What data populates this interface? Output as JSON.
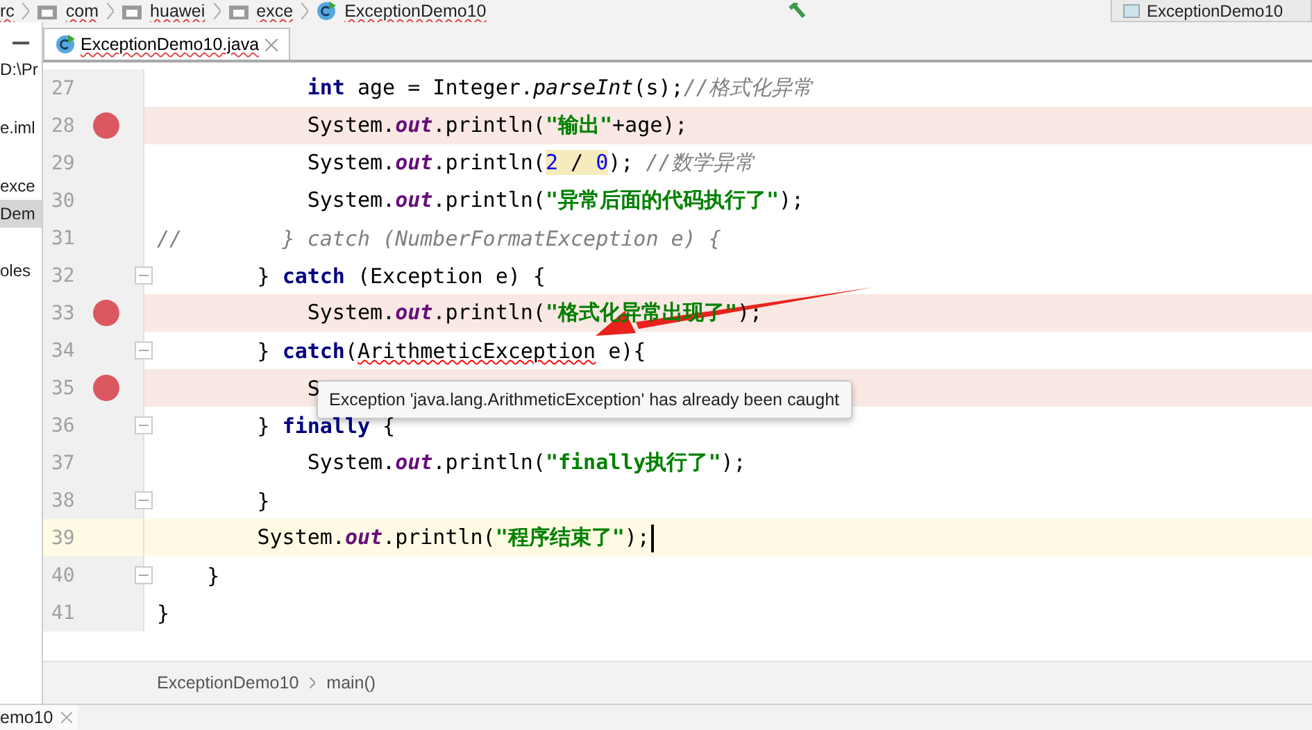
{
  "nav_bar": {
    "crumbs": [
      {
        "label": "rc",
        "kind": "text"
      },
      {
        "label": "com",
        "kind": "folder"
      },
      {
        "label": "huawei",
        "kind": "folder"
      },
      {
        "label": "exce",
        "kind": "folder"
      },
      {
        "label": "ExceptionDemo10",
        "kind": "class"
      }
    ],
    "run_config": "ExceptionDemo10"
  },
  "editor_tabs": [
    {
      "label": "ExceptionDemo10.java",
      "selected": true
    }
  ],
  "project_panel": {
    "items": [
      {
        "label": "D:\\Pr",
        "selected": false
      },
      {
        "label": "e.iml",
        "selected": false
      },
      {
        "label": "exce",
        "selected": false
      },
      {
        "label": "Dem",
        "selected": true
      },
      {
        "label": "oles",
        "selected": false
      }
    ]
  },
  "lines": [
    {
      "number": "27",
      "breakpoint": false,
      "current": false,
      "fold": false,
      "tokens": [
        {
          "text": "            int",
          "kind": "keyword"
        },
        {
          "text": " age = Integer.",
          "kind": "plain"
        },
        {
          "text": "parseInt",
          "kind": "method"
        },
        {
          "text": "(s);",
          "kind": "plain"
        },
        {
          "text": "//格式化异常",
          "kind": "comment"
        }
      ]
    },
    {
      "number": "28",
      "breakpoint": true,
      "current": false,
      "fold": false,
      "tokens": [
        {
          "text": "            System.",
          "kind": "plain"
        },
        {
          "text": "out",
          "kind": "field"
        },
        {
          "text": ".println(",
          "kind": "plain"
        },
        {
          "text": "\"输出\"",
          "kind": "string"
        },
        {
          "text": "+age);",
          "kind": "plain"
        }
      ]
    },
    {
      "number": "29",
      "breakpoint": false,
      "current": false,
      "fold": false,
      "tokens": [
        {
          "text": "            System.",
          "kind": "plain"
        },
        {
          "text": "out",
          "kind": "field"
        },
        {
          "text": ".println(",
          "kind": "plain"
        },
        {
          "text": "2",
          "kind": "number-marked"
        },
        {
          "text": " / ",
          "kind": "plain-marked"
        },
        {
          "text": "0",
          "kind": "number-marked"
        },
        {
          "text": "); ",
          "kind": "plain"
        },
        {
          "text": "//数学异常",
          "kind": "comment"
        }
      ]
    },
    {
      "number": "30",
      "breakpoint": false,
      "current": false,
      "fold": false,
      "tokens": [
        {
          "text": "            System.",
          "kind": "plain"
        },
        {
          "text": "out",
          "kind": "field"
        },
        {
          "text": ".println(",
          "kind": "plain"
        },
        {
          "text": "\"异常后面的代码执行了\"",
          "kind": "string"
        },
        {
          "text": ");",
          "kind": "plain"
        }
      ]
    },
    {
      "number": "31",
      "breakpoint": false,
      "current": false,
      "fold": false,
      "tokens": [
        {
          "text": "//        } catch (NumberFormatException e) {",
          "kind": "comment"
        }
      ]
    },
    {
      "number": "32",
      "breakpoint": false,
      "current": false,
      "fold": true,
      "tokens": [
        {
          "text": "        } ",
          "kind": "plain"
        },
        {
          "text": "catch",
          "kind": "keyword"
        },
        {
          "text": " (Exception e) {",
          "kind": "plain"
        }
      ]
    },
    {
      "number": "33",
      "breakpoint": true,
      "current": false,
      "fold": false,
      "tokens": [
        {
          "text": "            System.",
          "kind": "plain"
        },
        {
          "text": "out",
          "kind": "field"
        },
        {
          "text": ".println(",
          "kind": "plain"
        },
        {
          "text": "\"格式化异常出现了\"",
          "kind": "string"
        },
        {
          "text": ");",
          "kind": "plain"
        }
      ]
    },
    {
      "number": "34",
      "breakpoint": false,
      "current": false,
      "fold": true,
      "tokens": [
        {
          "text": "        } ",
          "kind": "plain"
        },
        {
          "text": "catch",
          "kind": "keyword"
        },
        {
          "text": "(",
          "kind": "plain"
        },
        {
          "text": "ArithmeticException",
          "kind": "error"
        },
        {
          "text": " e){",
          "kind": "plain"
        }
      ]
    },
    {
      "number": "35",
      "breakpoint": true,
      "current": false,
      "fold": false,
      "tokens": [
        {
          "text": "            S",
          "kind": "plain"
        }
      ]
    },
    {
      "number": "36",
      "breakpoint": false,
      "current": false,
      "fold": true,
      "tokens": [
        {
          "text": "        } ",
          "kind": "plain"
        },
        {
          "text": "finally",
          "kind": "keyword"
        },
        {
          "text": " {",
          "kind": "plain"
        }
      ]
    },
    {
      "number": "37",
      "breakpoint": false,
      "current": false,
      "fold": false,
      "tokens": [
        {
          "text": "            System.",
          "kind": "plain"
        },
        {
          "text": "out",
          "kind": "field"
        },
        {
          "text": ".println(",
          "kind": "plain"
        },
        {
          "text": "\"finally执行了\"",
          "kind": "string"
        },
        {
          "text": ");",
          "kind": "plain"
        }
      ]
    },
    {
      "number": "38",
      "breakpoint": false,
      "current": false,
      "fold": true,
      "tokens": [
        {
          "text": "        }",
          "kind": "plain"
        }
      ]
    },
    {
      "number": "39",
      "breakpoint": false,
      "current": true,
      "fold": false,
      "tokens": [
        {
          "text": "        System.",
          "kind": "plain"
        },
        {
          "text": "out",
          "kind": "field"
        },
        {
          "text": ".println(",
          "kind": "plain"
        },
        {
          "text": "\"程序结束了\"",
          "kind": "string"
        },
        {
          "text": ");",
          "kind": "plain"
        }
      ]
    },
    {
      "number": "40",
      "breakpoint": false,
      "current": false,
      "fold": true,
      "tokens": [
        {
          "text": "    }",
          "kind": "plain"
        }
      ]
    },
    {
      "number": "41",
      "breakpoint": false,
      "current": false,
      "fold": false,
      "tokens": [
        {
          "text": "}",
          "kind": "plain"
        }
      ]
    }
  ],
  "tooltip": "Exception 'java.lang.ArithmeticException' has already been caught",
  "breadcrumbs": [
    "ExceptionDemo10",
    "main()"
  ],
  "bottom_tab": {
    "label": "emo10"
  }
}
